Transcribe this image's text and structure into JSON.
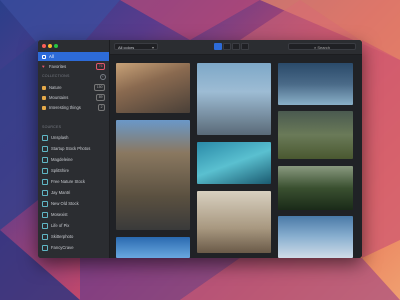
{
  "sidebar": {
    "library": [
      {
        "label": "All",
        "icon": "grid-icon",
        "count": "",
        "active": true
      },
      {
        "label": "Favorites",
        "icon": "heart-icon",
        "count": "76",
        "active": false
      }
    ],
    "collections_header": "COLLECTIONS",
    "collections": [
      {
        "label": "Nature",
        "count": "150"
      },
      {
        "label": "Mountains",
        "count": "89"
      },
      {
        "label": "Interesting things",
        "count": "2"
      }
    ],
    "sources_header": "SOURCES",
    "sources": [
      {
        "label": "Unsplash"
      },
      {
        "label": "Startup Stock Photos"
      },
      {
        "label": "Magdeleine"
      },
      {
        "label": "SplitShire"
      },
      {
        "label": "Free Nature Stock"
      },
      {
        "label": "Jay Mantri"
      },
      {
        "label": "New Old Stock"
      },
      {
        "label": "Mosexist"
      },
      {
        "label": "Life of Pix"
      },
      {
        "label": "Skitterphoto"
      },
      {
        "label": "FancyCrave"
      }
    ]
  },
  "toolbar": {
    "color_filter": "All colors",
    "search_label": "Search",
    "view_modes": [
      "grid-view-icon",
      "single-view-icon",
      "split-view-icon",
      "list-view-icon"
    ]
  },
  "photos": [
    {
      "name": "city-buildings-photo"
    },
    {
      "name": "modern-architecture-photo"
    },
    {
      "name": "snowy-lake-photo"
    },
    {
      "name": "european-street-photo"
    },
    {
      "name": "wind-turbines-photo"
    },
    {
      "name": "surfer-wave-photo"
    },
    {
      "name": "green-mountains-photo"
    },
    {
      "name": "paris-eiffel-photo"
    },
    {
      "name": "bison-snow-photo"
    },
    {
      "name": "blue-sky-photo"
    }
  ],
  "colors": {
    "accent": "#2d6bd8",
    "folder": "#e4a94a",
    "source_icon": "#5fb6c4"
  }
}
